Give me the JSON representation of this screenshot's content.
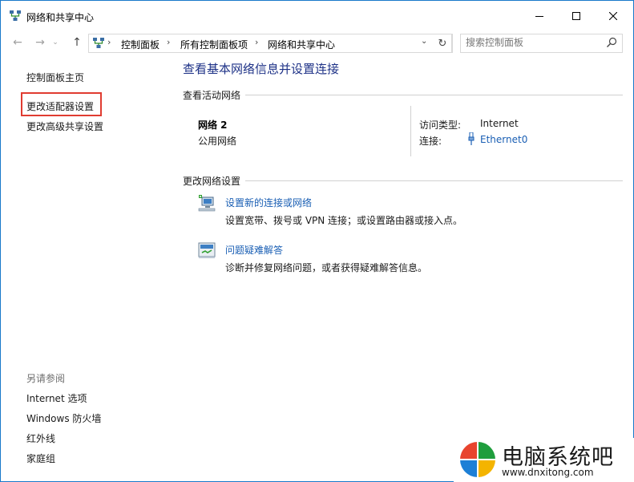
{
  "window": {
    "title": "网络和共享中心",
    "icon": "network-sharing-center-icon",
    "controls": [
      "minimize-icon",
      "maximize-icon",
      "close-icon"
    ]
  },
  "address_bar": {
    "breadcrumbs": [
      "控制面板",
      "所有控制面板项",
      "网络和共享中心"
    ],
    "search_placeholder": "搜索控制面板"
  },
  "left_nav": {
    "home": "控制面板主页",
    "links": [
      "更改适配器设置",
      "更改高级共享设置"
    ],
    "highlighted_link": "更改适配器设置",
    "highlight_color": "#e03c31",
    "see_also_label": "另请参阅",
    "see_also": [
      "Internet 选项",
      "Windows 防火墙",
      "红外线",
      "家庭组"
    ]
  },
  "main": {
    "title": "查看基本网络信息并设置连接",
    "active_networks_label": "查看活动网络",
    "network": {
      "name": "网络  2",
      "type": "公用网络",
      "access_type_label": "访问类型:",
      "access_type": "Internet",
      "connections_label": "连接:",
      "connection": "Ethernet0"
    },
    "change_settings_label": "更改网络设置",
    "tasks": [
      {
        "icon": "new-connection-icon",
        "link": "设置新的连接或网络",
        "desc": "设置宽带、拨号或 VPN 连接；或设置路由器或接入点。"
      },
      {
        "icon": "troubleshoot-icon",
        "link": "问题疑难解答",
        "desc": "诊断并修复网络问题，或者获得疑难解答信息。"
      }
    ]
  },
  "watermark": {
    "text": "电脑系统吧",
    "url": "www.dnxitong.com"
  },
  "colors": {
    "title_blue": "#1e3287",
    "link_blue": "#1a5fb4",
    "window_border": "#1979ca"
  }
}
